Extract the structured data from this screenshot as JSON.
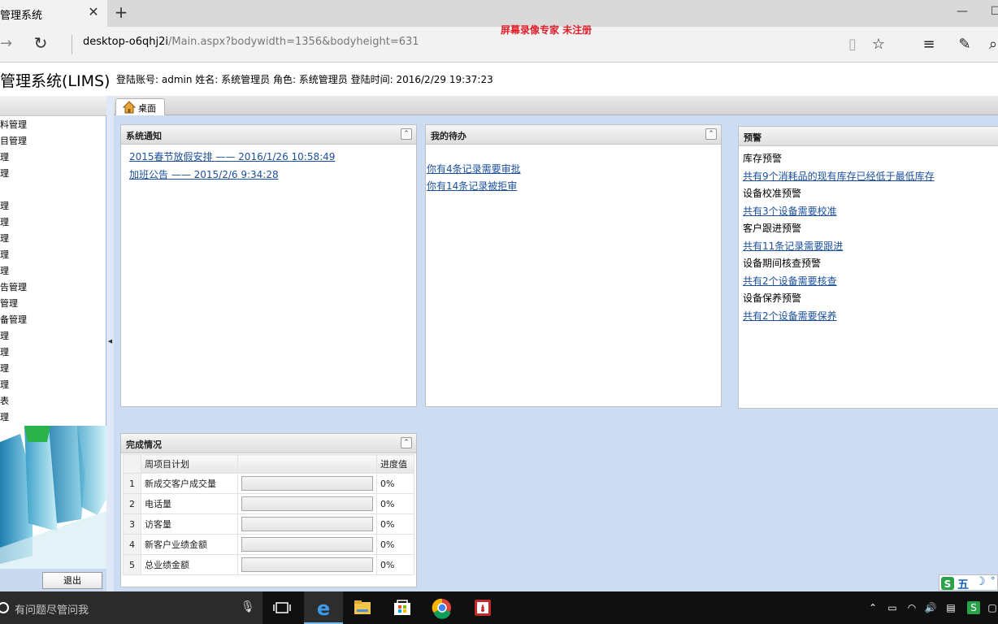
{
  "browser": {
    "tab_title": "管理系统",
    "tab_close": "✕",
    "new_tab": "+",
    "url_host": "desktop-o6qhj2i",
    "url_path": "/Main.aspx?bodywidth=1356&bodyheight=631",
    "watermark": "屏幕录像专家  未注册"
  },
  "app": {
    "title": "管理系统(LIMS)",
    "login_info": "登陆账号: admin 姓名: 系统管理员 角色: 系统管理员 登陆时间: 2016/2/29 19:37:23"
  },
  "sidebar": {
    "items": [
      "料管理",
      "目管理",
      "理",
      "理",
      "",
      "理",
      "理",
      "理",
      "理",
      "理",
      "告管理",
      "管理",
      "备管理",
      "理",
      "理",
      "理",
      "理",
      "表",
      "理"
    ],
    "logout_label": "退出"
  },
  "main_tab": {
    "label": "桌面"
  },
  "notice_panel": {
    "title": "系统通知",
    "links": [
      "2015春节放假安排 —— 2016/1/26 10:58:49",
      "加班公告 —— 2015/2/6 9:34:28"
    ]
  },
  "todo_panel": {
    "title": "我的待办",
    "links": [
      "你有4条记录需要审批",
      "你有14条记录被拒审"
    ]
  },
  "alert_panel": {
    "title": "预警",
    "entries": [
      {
        "kind": "label",
        "text": "库存预警"
      },
      {
        "kind": "link",
        "text": "共有9个消耗品的现有库存已经低于最低库存"
      },
      {
        "kind": "label",
        "text": "设备校准预警"
      },
      {
        "kind": "link",
        "text": "共有3个设备需要校准"
      },
      {
        "kind": "label",
        "text": "客户跟进预警"
      },
      {
        "kind": "link",
        "text": "共有11条记录需要跟进"
      },
      {
        "kind": "label",
        "text": "设备期间核查预警"
      },
      {
        "kind": "link",
        "text": "共有2个设备需要核查"
      },
      {
        "kind": "label",
        "text": "设备保养预警"
      },
      {
        "kind": "link",
        "text": "共有2个设备需要保养"
      }
    ]
  },
  "progress_panel": {
    "title": "完成情况",
    "columns": [
      "周项目计划",
      "",
      "进度值"
    ],
    "rows": [
      {
        "num": "1",
        "name": "新成交客户成交量",
        "progress": 0,
        "value": "0%"
      },
      {
        "num": "2",
        "name": "电话量",
        "progress": 0,
        "value": "0%"
      },
      {
        "num": "3",
        "name": "访客量",
        "progress": 0,
        "value": "0%"
      },
      {
        "num": "4",
        "name": "新客户业绩金额",
        "progress": 0,
        "value": "0%"
      },
      {
        "num": "5",
        "name": "总业绩金额",
        "progress": 0,
        "value": "0%"
      }
    ]
  },
  "ime": {
    "label": "五"
  },
  "taskbar": {
    "search_placeholder": "有问题尽管问我",
    "apps": [
      "task-view-icon",
      "edge-icon",
      "file-explorer-icon",
      "store-icon",
      "chrome-icon",
      "app-red-icon"
    ]
  },
  "colors": {
    "link": "#1a4f9c",
    "main_bg": "#ccdcf2",
    "watermark": "#e0202a",
    "taskbar": "#101010"
  }
}
